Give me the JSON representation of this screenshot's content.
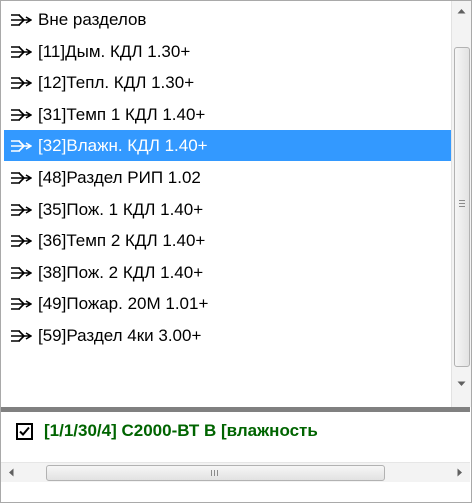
{
  "partitions": {
    "items": [
      {
        "label": "Вне разделов",
        "selected": false,
        "icon": "partition-arrow-icon"
      },
      {
        "label": "[11]Дым. КДЛ 1.30+",
        "selected": false,
        "icon": "partition-arrow-icon"
      },
      {
        "label": "[12]Тепл. КДЛ 1.30+",
        "selected": false,
        "icon": "partition-arrow-icon"
      },
      {
        "label": "[31]Темп 1 КДЛ 1.40+",
        "selected": false,
        "icon": "partition-arrow-icon"
      },
      {
        "label": "[32]Влажн. КДЛ 1.40+",
        "selected": true,
        "icon": "partition-arrow-icon"
      },
      {
        "label": "[48]Раздел РИП 1.02",
        "selected": false,
        "icon": "partition-arrow-icon"
      },
      {
        "label": "[35]Пож. 1 КДЛ 1.40+",
        "selected": false,
        "icon": "partition-arrow-icon"
      },
      {
        "label": "[36]Темп 2 КДЛ 1.40+",
        "selected": false,
        "icon": "partition-arrow-icon"
      },
      {
        "label": "[38]Пож. 2 КДЛ 1.40+",
        "selected": false,
        "icon": "partition-arrow-icon"
      },
      {
        "label": "[49]Пожар. 20М 1.01+",
        "selected": false,
        "icon": "partition-arrow-icon"
      },
      {
        "label": "[59]Раздел 4ки 3.00+",
        "selected": false,
        "icon": "partition-arrow-icon"
      }
    ]
  },
  "zones": {
    "items": [
      {
        "label": "[1/1/30/4] С2000-ВТ В [влажность",
        "checked": true
      }
    ]
  },
  "colors": {
    "selection": "#3399ff",
    "zone_text": "#006400",
    "splitter": "#808080"
  },
  "vscroll": {
    "up_icon": "scroll-up-arrow-icon",
    "down_icon": "scroll-down-arrow-icon"
  },
  "hscroll": {
    "left_icon": "scroll-left-arrow-icon",
    "right_icon": "scroll-right-arrow-icon"
  }
}
